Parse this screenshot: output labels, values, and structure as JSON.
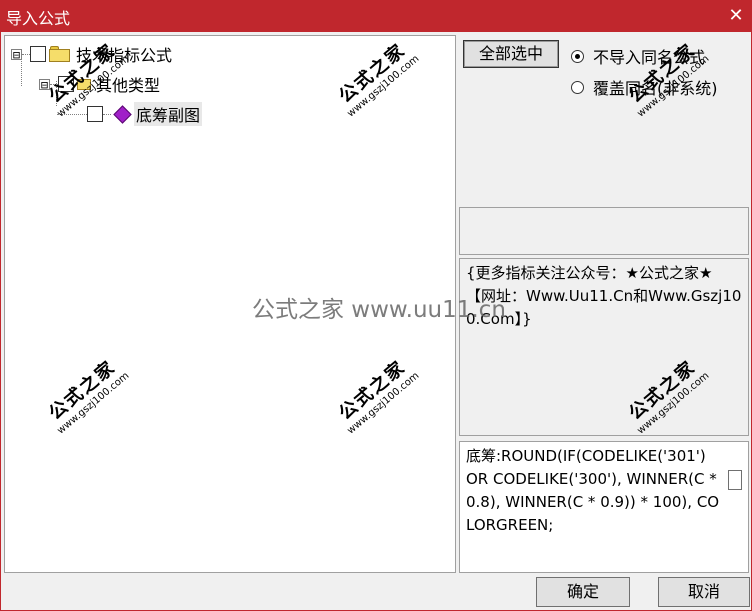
{
  "window": {
    "title": "导入公式",
    "close_label": "✕"
  },
  "tree": {
    "root_label": "技术指标公式",
    "child_label": "其他类型",
    "leaf_label": "底筹副图",
    "expander_symbol": "⊟"
  },
  "options": {
    "select_all_label": "全部选中",
    "radio_no_import": "不导入同名公式",
    "radio_overwrite": "覆盖同名(非系统)",
    "selected": "no_import"
  },
  "info_text": "{更多指标关注公众号：★公式之家★ 【网址：Www.Uu11.Cn和Www.Gszj100.Com】}",
  "formula_text": "底筹:ROUND(IF(CODELIKE('301') OR CODELIKE('300'), WINNER(C * 0.8), WINNER(C * 0.9)) * 100), COLORGREEN;",
  "buttons": {
    "ok_label": "确定",
    "cancel_label": "取消"
  },
  "watermark": {
    "cn": "公式之家",
    "url": "www.gszj100.com",
    "center_text": "公式之家 www.uu11.cn"
  },
  "colors": {
    "titlebar": "#c0272d",
    "gem": "#a020c8",
    "folder": "#f5dd6a"
  }
}
